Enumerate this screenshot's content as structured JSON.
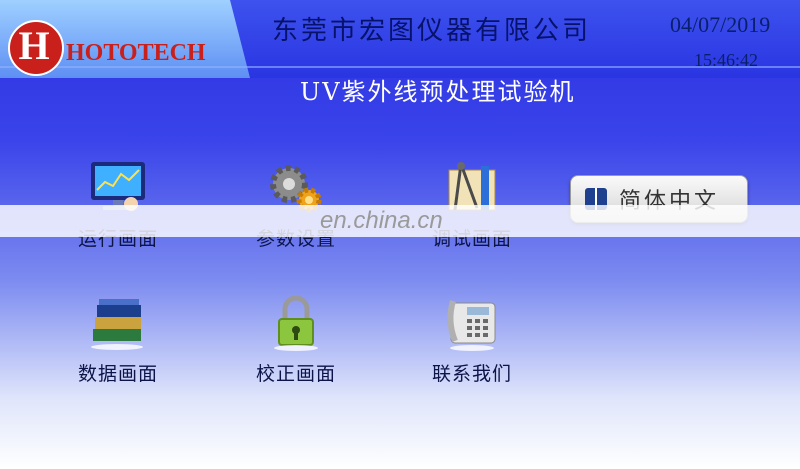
{
  "header": {
    "logo_text": "HOTOTECH",
    "company": "东莞市宏图仪器有限公司",
    "date": "04/07/2019",
    "time": "15:46:42",
    "title": "UV紫外线预处理试验机"
  },
  "menu": {
    "items": [
      {
        "label": "运行画面",
        "icon": "monitor-icon"
      },
      {
        "label": "参数设置",
        "icon": "gears-icon"
      },
      {
        "label": "调试画面",
        "icon": "drafting-tools-icon"
      },
      {
        "label": "数据画面",
        "icon": "books-icon"
      },
      {
        "label": "校正画面",
        "icon": "padlock-icon"
      },
      {
        "label": "联系我们",
        "icon": "telephone-icon"
      }
    ]
  },
  "language_button": {
    "label": "简体中文"
  },
  "watermark": "en.china.cn",
  "colors": {
    "accent": "#2b2fe0",
    "brand_red": "#c9201c"
  }
}
